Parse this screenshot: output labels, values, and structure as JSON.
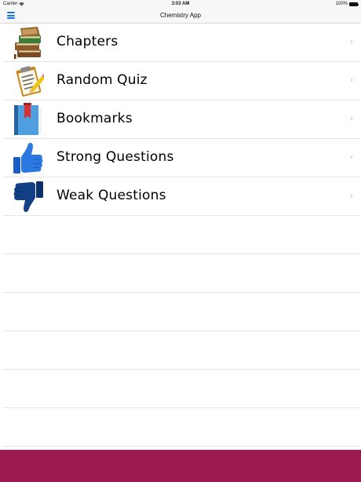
{
  "status_bar": {
    "carrier": "Carrier",
    "time": "3:03 AM",
    "battery": "100%",
    "battery_level": 1.0
  },
  "nav_bar": {
    "title": "Chemistry App",
    "menu_icon": "hamburger-menu-icon",
    "accent_color": "#1a73e8"
  },
  "menu_items": [
    {
      "label": "Chapters",
      "icon": "books-icon",
      "chevron": "›"
    },
    {
      "label": "Random Quiz",
      "icon": "quiz-clipboard-icon",
      "chevron": "›"
    },
    {
      "label": "Bookmarks",
      "icon": "bookmark-book-icon",
      "chevron": "›"
    },
    {
      "label": "Strong Questions",
      "icon": "thumbs-up-icon",
      "chevron": "›"
    },
    {
      "label": "Weak Questions",
      "icon": "thumbs-down-icon",
      "chevron": "›"
    }
  ],
  "footer": {
    "color": "#9c1a50"
  }
}
